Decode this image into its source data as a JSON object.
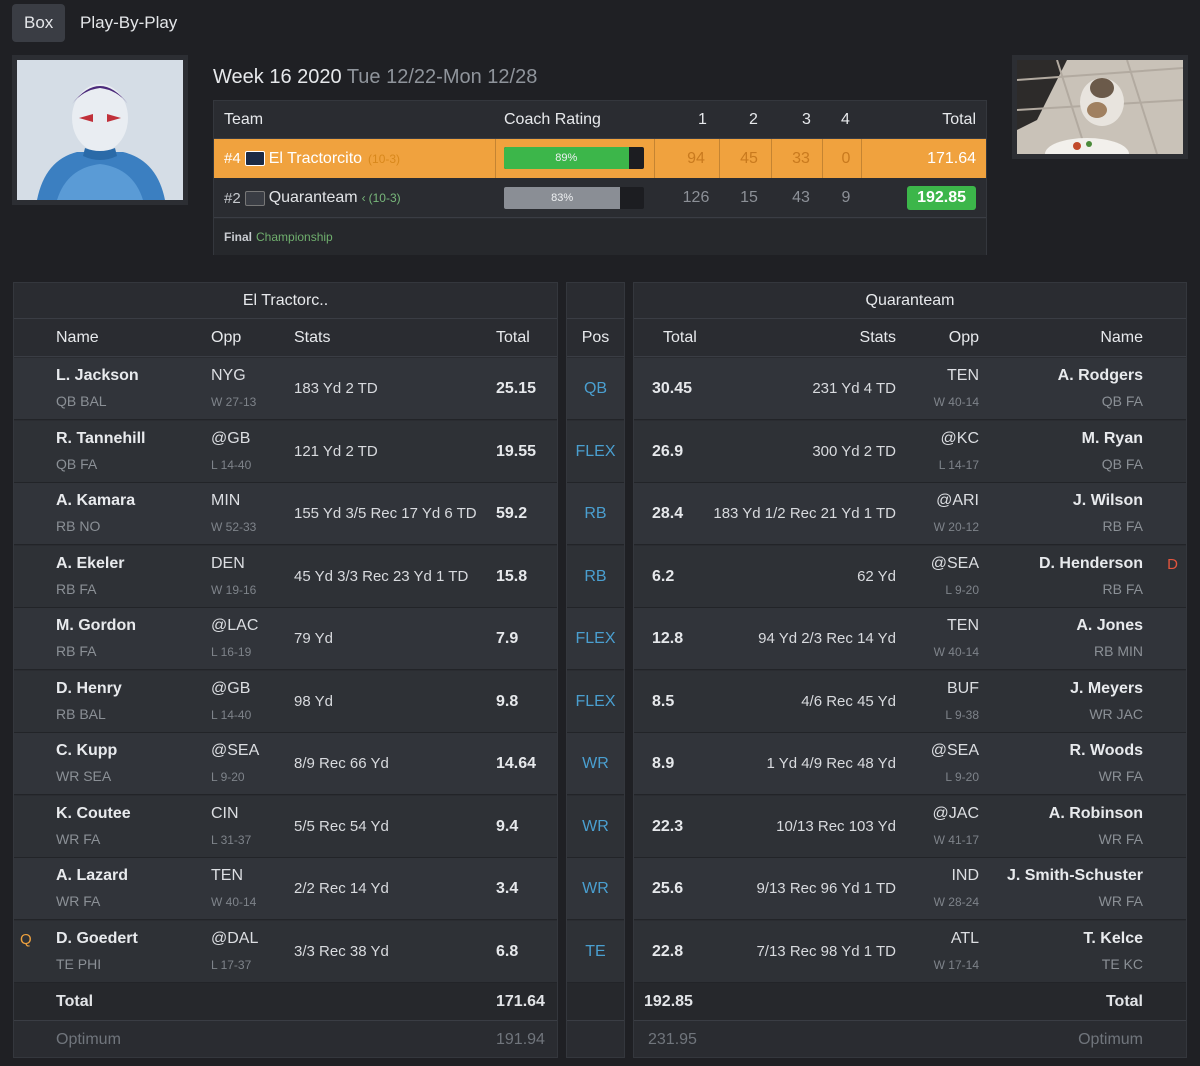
{
  "tabs": [
    {
      "label": "Box"
    },
    {
      "label": "Play-By-Play"
    }
  ],
  "header": {
    "week": "Week 16 2020",
    "range": "Tue 12/22-Mon 12/28"
  },
  "scoreboard": {
    "cols": {
      "team": "Team",
      "coach": "Coach Rating",
      "q1": "1",
      "q2": "2",
      "q3": "3",
      "q4": "4",
      "total": "Total"
    },
    "rows": [
      {
        "seed": "#4",
        "name": "El Tractorcito",
        "record": "(10-3)",
        "rating": "89%",
        "rating_value": 0.89,
        "q": [
          "94",
          "45",
          "33",
          "0"
        ],
        "total": "171.64"
      },
      {
        "seed": "#2",
        "name": "Quaranteam",
        "arrow": "‹",
        "record": "(10-3)",
        "rating": "83%",
        "rating_value": 0.83,
        "q": [
          "126",
          "15",
          "43",
          "9"
        ],
        "total": "192.85"
      }
    ],
    "final_label": "Final",
    "final_sub": "Championship"
  },
  "left_table": {
    "title": "El Tractorc..",
    "cols": {
      "name": "Name",
      "opp": "Opp",
      "stats": "Stats",
      "total": "Total"
    },
    "players": [
      {
        "name": "L. Jackson",
        "pos_team": "QB BAL",
        "opp": "NYG",
        "result": "W 27-13",
        "stats": "183 Yd 2 TD",
        "total": "25.15",
        "flag": ""
      },
      {
        "name": "R. Tannehill",
        "pos_team": "QB FA",
        "opp": "@GB",
        "result": "L 14-40",
        "stats": "121 Yd 2 TD",
        "total": "19.55",
        "flag": ""
      },
      {
        "name": "A. Kamara",
        "pos_team": "RB NO",
        "opp": "MIN",
        "result": "W 52-33",
        "stats": "155 Yd 3/5 Rec 17 Yd 6 TD",
        "total": "59.2",
        "flag": ""
      },
      {
        "name": "A. Ekeler",
        "pos_team": "RB FA",
        "opp": "DEN",
        "result": "W 19-16",
        "stats": "45 Yd 3/3 Rec 23 Yd 1 TD",
        "total": "15.8",
        "flag": ""
      },
      {
        "name": "M. Gordon",
        "pos_team": "RB FA",
        "opp": "@LAC",
        "result": "L 16-19",
        "stats": "79 Yd",
        "total": "7.9",
        "flag": ""
      },
      {
        "name": "D. Henry",
        "pos_team": "RB BAL",
        "opp": "@GB",
        "result": "L 14-40",
        "stats": "98 Yd",
        "total": "9.8",
        "flag": ""
      },
      {
        "name": "C. Kupp",
        "pos_team": "WR SEA",
        "opp": "@SEA",
        "result": "L 9-20",
        "stats": "8/9 Rec 66 Yd",
        "total": "14.64",
        "flag": ""
      },
      {
        "name": "K. Coutee",
        "pos_team": "WR FA",
        "opp": "CIN",
        "result": "L 31-37",
        "stats": "5/5 Rec 54 Yd",
        "total": "9.4",
        "flag": ""
      },
      {
        "name": "A. Lazard",
        "pos_team": "WR FA",
        "opp": "TEN",
        "result": "W 40-14",
        "stats": "2/2 Rec 14 Yd",
        "total": "3.4",
        "flag": ""
      },
      {
        "name": "D. Goedert",
        "pos_team": "TE PHI",
        "opp": "@DAL",
        "result": "L 17-37",
        "stats": "3/3 Rec 38 Yd",
        "total": "6.8",
        "flag": "Q"
      }
    ],
    "total_label": "Total",
    "total_value": "171.64",
    "optimum_label": "Optimum",
    "optimum_value": "191.94"
  },
  "positions": {
    "header": "Pos",
    "items": [
      "QB",
      "FLEX",
      "RB",
      "RB",
      "FLEX",
      "FLEX",
      "WR",
      "WR",
      "WR",
      "TE"
    ]
  },
  "right_table": {
    "title": "Quaranteam",
    "cols": {
      "total": "Total",
      "stats": "Stats",
      "opp": "Opp",
      "name": "Name"
    },
    "players": [
      {
        "name": "A. Rodgers",
        "pos_team": "QB FA",
        "opp": "TEN",
        "result": "W 40-14",
        "stats": "231 Yd 4 TD",
        "total": "30.45",
        "flag": ""
      },
      {
        "name": "M. Ryan",
        "pos_team": "QB FA",
        "opp": "@KC",
        "result": "L 14-17",
        "stats": "300 Yd 2 TD",
        "total": "26.9",
        "flag": ""
      },
      {
        "name": "J. Wilson",
        "pos_team": "RB FA",
        "opp": "@ARI",
        "result": "W 20-12",
        "stats": "183 Yd 1/2 Rec 21 Yd 1 TD",
        "total": "28.4",
        "flag": ""
      },
      {
        "name": "D. Henderson",
        "pos_team": "RB FA",
        "opp": "@SEA",
        "result": "L 9-20",
        "stats": "62 Yd",
        "total": "6.2",
        "flag": "D"
      },
      {
        "name": "A. Jones",
        "pos_team": "RB MIN",
        "opp": "TEN",
        "result": "W 40-14",
        "stats": "94 Yd 2/3 Rec 14 Yd",
        "total": "12.8",
        "flag": ""
      },
      {
        "name": "J. Meyers",
        "pos_team": "WR JAC",
        "opp": "BUF",
        "result": "L 9-38",
        "stats": "4/6 Rec 45 Yd",
        "total": "8.5",
        "flag": ""
      },
      {
        "name": "R. Woods",
        "pos_team": "WR FA",
        "opp": "@SEA",
        "result": "L 9-20",
        "stats": "1 Yd 4/9 Rec 48 Yd",
        "total": "8.9",
        "flag": ""
      },
      {
        "name": "A. Robinson",
        "pos_team": "WR FA",
        "opp": "@JAC",
        "result": "W 41-17",
        "stats": "10/13 Rec 103 Yd",
        "total": "22.3",
        "flag": ""
      },
      {
        "name": "J. Smith-Schuster",
        "pos_team": "WR FA",
        "opp": "IND",
        "result": "W 28-24",
        "stats": "9/13 Rec 96 Yd 1 TD",
        "total": "25.6",
        "flag": ""
      },
      {
        "name": "T. Kelce",
        "pos_team": "TE KC",
        "opp": "ATL",
        "result": "W 17-14",
        "stats": "7/13 Rec 98 Yd 1 TD",
        "total": "22.8",
        "flag": ""
      }
    ],
    "total_label": "Total",
    "total_value": "192.85",
    "optimum_label": "Optimum",
    "optimum_value": "231.95"
  },
  "colors": {
    "accent": "#f0a23e",
    "winner": "#3cb64a",
    "position": "#4a9fd0",
    "background": "#1f2024"
  }
}
